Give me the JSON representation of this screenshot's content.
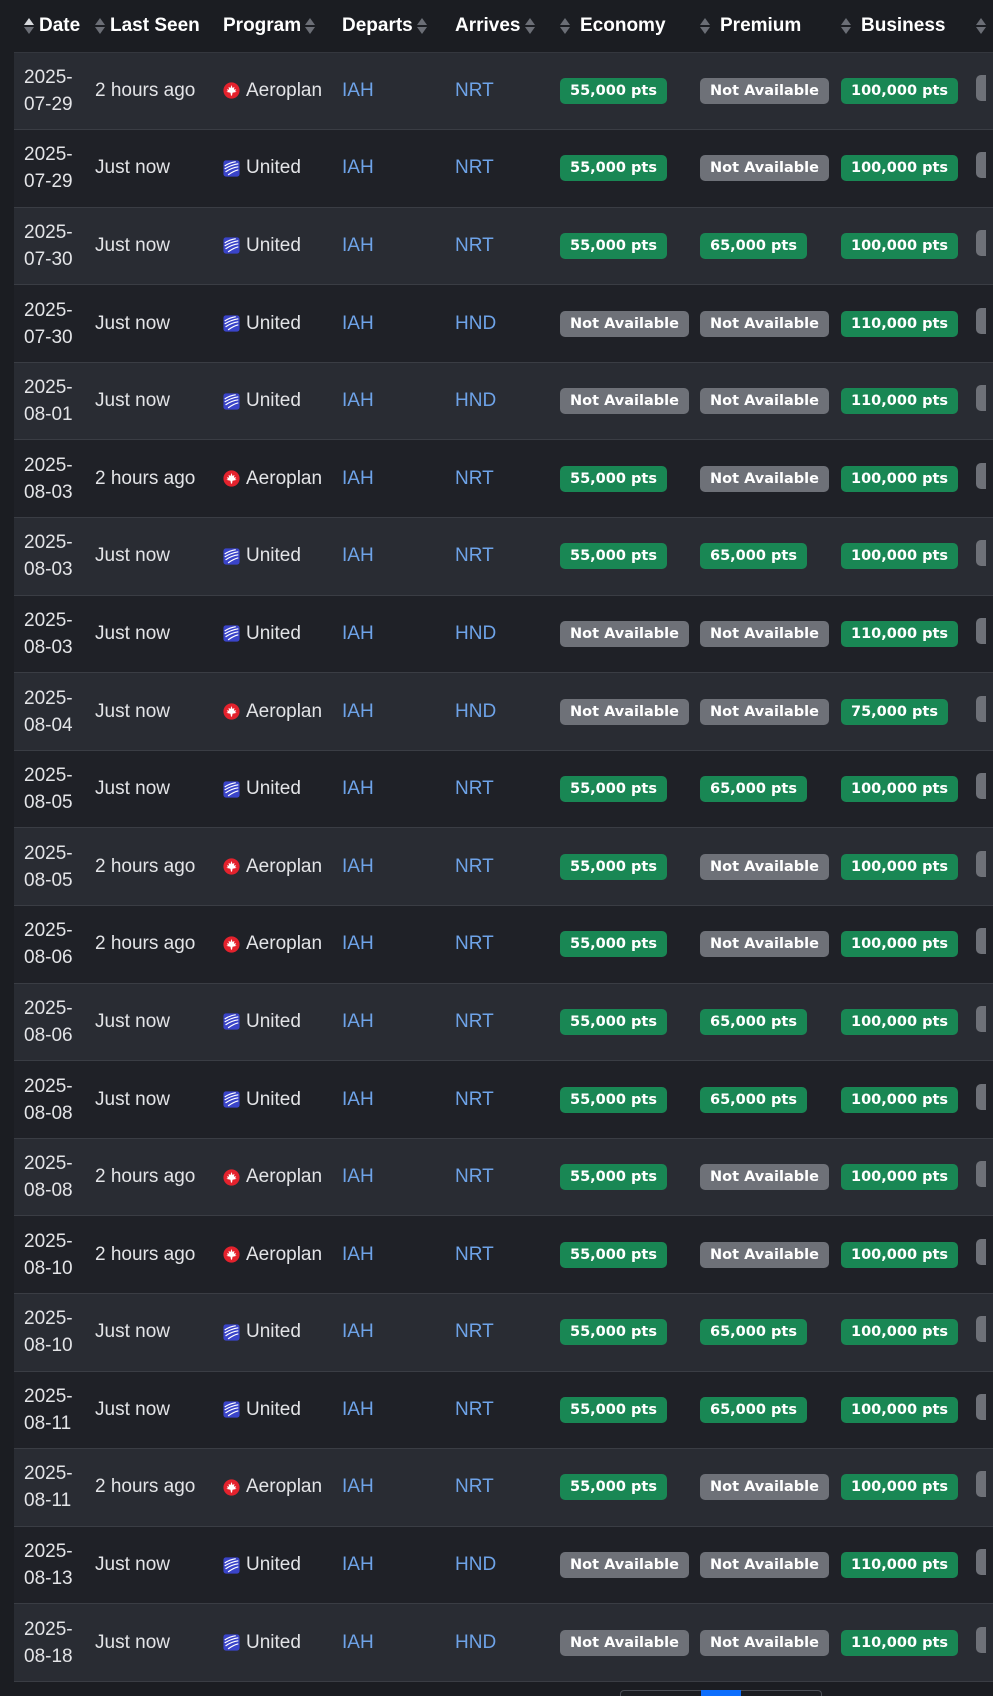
{
  "table": {
    "headers": {
      "date": "Date",
      "last_seen": "Last Seen",
      "program": "Program",
      "departs": "Departs",
      "arrives": "Arrives",
      "economy": "Economy",
      "premium": "Premium",
      "business": "Business"
    },
    "sort": {
      "column": "date",
      "direction": "ascending"
    },
    "colors": {
      "available_badge": "#198754",
      "unavailable_badge": "#6e7178",
      "link": "#6ea3e8",
      "aeroplan_logo": "#e4222d",
      "united_logo": "#3a44c9"
    },
    "rows": [
      {
        "date_year": "2025-",
        "date_md": "07-29",
        "last_seen": "2 hours ago",
        "program": "Aeroplan",
        "program_icon": "aeroplan-icon",
        "departs": "IAH",
        "arrives": "NRT",
        "economy": "55,000 pts",
        "economy_status": "available",
        "premium": "Not Available",
        "premium_status": "unavailable",
        "business": "100,000 pts",
        "business_status": "available"
      },
      {
        "date_year": "2025-",
        "date_md": "07-29",
        "last_seen": "Just now",
        "program": "United",
        "program_icon": "united-icon",
        "departs": "IAH",
        "arrives": "NRT",
        "economy": "55,000 pts",
        "economy_status": "available",
        "premium": "Not Available",
        "premium_status": "unavailable",
        "business": "100,000 pts",
        "business_status": "available"
      },
      {
        "date_year": "2025-",
        "date_md": "07-30",
        "last_seen": "Just now",
        "program": "United",
        "program_icon": "united-icon",
        "departs": "IAH",
        "arrives": "NRT",
        "economy": "55,000 pts",
        "economy_status": "available",
        "premium": "65,000 pts",
        "premium_status": "available",
        "business": "100,000 pts",
        "business_status": "available"
      },
      {
        "date_year": "2025-",
        "date_md": "07-30",
        "last_seen": "Just now",
        "program": "United",
        "program_icon": "united-icon",
        "departs": "IAH",
        "arrives": "HND",
        "economy": "Not Available",
        "economy_status": "unavailable",
        "premium": "Not Available",
        "premium_status": "unavailable",
        "business": "110,000 pts",
        "business_status": "available"
      },
      {
        "date_year": "2025-",
        "date_md": "08-01",
        "last_seen": "Just now",
        "program": "United",
        "program_icon": "united-icon",
        "departs": "IAH",
        "arrives": "HND",
        "economy": "Not Available",
        "economy_status": "unavailable",
        "premium": "Not Available",
        "premium_status": "unavailable",
        "business": "110,000 pts",
        "business_status": "available"
      },
      {
        "date_year": "2025-",
        "date_md": "08-03",
        "last_seen": "2 hours ago",
        "program": "Aeroplan",
        "program_icon": "aeroplan-icon",
        "departs": "IAH",
        "arrives": "NRT",
        "economy": "55,000 pts",
        "economy_status": "available",
        "premium": "Not Available",
        "premium_status": "unavailable",
        "business": "100,000 pts",
        "business_status": "available"
      },
      {
        "date_year": "2025-",
        "date_md": "08-03",
        "last_seen": "Just now",
        "program": "United",
        "program_icon": "united-icon",
        "departs": "IAH",
        "arrives": "NRT",
        "economy": "55,000 pts",
        "economy_status": "available",
        "premium": "65,000 pts",
        "premium_status": "available",
        "business": "100,000 pts",
        "business_status": "available"
      },
      {
        "date_year": "2025-",
        "date_md": "08-03",
        "last_seen": "Just now",
        "program": "United",
        "program_icon": "united-icon",
        "departs": "IAH",
        "arrives": "HND",
        "economy": "Not Available",
        "economy_status": "unavailable",
        "premium": "Not Available",
        "premium_status": "unavailable",
        "business": "110,000 pts",
        "business_status": "available"
      },
      {
        "date_year": "2025-",
        "date_md": "08-04",
        "last_seen": "Just now",
        "program": "Aeroplan",
        "program_icon": "aeroplan-icon",
        "departs": "IAH",
        "arrives": "HND",
        "economy": "Not Available",
        "economy_status": "unavailable",
        "premium": "Not Available",
        "premium_status": "unavailable",
        "business": "75,000 pts",
        "business_status": "available"
      },
      {
        "date_year": "2025-",
        "date_md": "08-05",
        "last_seen": "Just now",
        "program": "United",
        "program_icon": "united-icon",
        "departs": "IAH",
        "arrives": "NRT",
        "economy": "55,000 pts",
        "economy_status": "available",
        "premium": "65,000 pts",
        "premium_status": "available",
        "business": "100,000 pts",
        "business_status": "available"
      },
      {
        "date_year": "2025-",
        "date_md": "08-05",
        "last_seen": "2 hours ago",
        "program": "Aeroplan",
        "program_icon": "aeroplan-icon",
        "departs": "IAH",
        "arrives": "NRT",
        "economy": "55,000 pts",
        "economy_status": "available",
        "premium": "Not Available",
        "premium_status": "unavailable",
        "business": "100,000 pts",
        "business_status": "available"
      },
      {
        "date_year": "2025-",
        "date_md": "08-06",
        "last_seen": "2 hours ago",
        "program": "Aeroplan",
        "program_icon": "aeroplan-icon",
        "departs": "IAH",
        "arrives": "NRT",
        "economy": "55,000 pts",
        "economy_status": "available",
        "premium": "Not Available",
        "premium_status": "unavailable",
        "business": "100,000 pts",
        "business_status": "available"
      },
      {
        "date_year": "2025-",
        "date_md": "08-06",
        "last_seen": "Just now",
        "program": "United",
        "program_icon": "united-icon",
        "departs": "IAH",
        "arrives": "NRT",
        "economy": "55,000 pts",
        "economy_status": "available",
        "premium": "65,000 pts",
        "premium_status": "available",
        "business": "100,000 pts",
        "business_status": "available"
      },
      {
        "date_year": "2025-",
        "date_md": "08-08",
        "last_seen": "Just now",
        "program": "United",
        "program_icon": "united-icon",
        "departs": "IAH",
        "arrives": "NRT",
        "economy": "55,000 pts",
        "economy_status": "available",
        "premium": "65,000 pts",
        "premium_status": "available",
        "business": "100,000 pts",
        "business_status": "available"
      },
      {
        "date_year": "2025-",
        "date_md": "08-08",
        "last_seen": "2 hours ago",
        "program": "Aeroplan",
        "program_icon": "aeroplan-icon",
        "departs": "IAH",
        "arrives": "NRT",
        "economy": "55,000 pts",
        "economy_status": "available",
        "premium": "Not Available",
        "premium_status": "unavailable",
        "business": "100,000 pts",
        "business_status": "available"
      },
      {
        "date_year": "2025-",
        "date_md": "08-10",
        "last_seen": "2 hours ago",
        "program": "Aeroplan",
        "program_icon": "aeroplan-icon",
        "departs": "IAH",
        "arrives": "NRT",
        "economy": "55,000 pts",
        "economy_status": "available",
        "premium": "Not Available",
        "premium_status": "unavailable",
        "business": "100,000 pts",
        "business_status": "available"
      },
      {
        "date_year": "2025-",
        "date_md": "08-10",
        "last_seen": "Just now",
        "program": "United",
        "program_icon": "united-icon",
        "departs": "IAH",
        "arrives": "NRT",
        "economy": "55,000 pts",
        "economy_status": "available",
        "premium": "65,000 pts",
        "premium_status": "available",
        "business": "100,000 pts",
        "business_status": "available"
      },
      {
        "date_year": "2025-",
        "date_md": "08-11",
        "last_seen": "Just now",
        "program": "United",
        "program_icon": "united-icon",
        "departs": "IAH",
        "arrives": "NRT",
        "economy": "55,000 pts",
        "economy_status": "available",
        "premium": "65,000 pts",
        "premium_status": "available",
        "business": "100,000 pts",
        "business_status": "available"
      },
      {
        "date_year": "2025-",
        "date_md": "08-11",
        "last_seen": "2 hours ago",
        "program": "Aeroplan",
        "program_icon": "aeroplan-icon",
        "departs": "IAH",
        "arrives": "NRT",
        "economy": "55,000 pts",
        "economy_status": "available",
        "premium": "Not Available",
        "premium_status": "unavailable",
        "business": "100,000 pts",
        "business_status": "available"
      },
      {
        "date_year": "2025-",
        "date_md": "08-13",
        "last_seen": "Just now",
        "program": "United",
        "program_icon": "united-icon",
        "departs": "IAH",
        "arrives": "HND",
        "economy": "Not Available",
        "economy_status": "unavailable",
        "premium": "Not Available",
        "premium_status": "unavailable",
        "business": "110,000 pts",
        "business_status": "available"
      },
      {
        "date_year": "2025-",
        "date_md": "08-18",
        "last_seen": "Just now",
        "program": "United",
        "program_icon": "united-icon",
        "departs": "IAH",
        "arrives": "HND",
        "economy": "Not Available",
        "economy_status": "unavailable",
        "premium": "Not Available",
        "premium_status": "unavailable",
        "business": "110,000 pts",
        "business_status": "available"
      }
    ]
  }
}
